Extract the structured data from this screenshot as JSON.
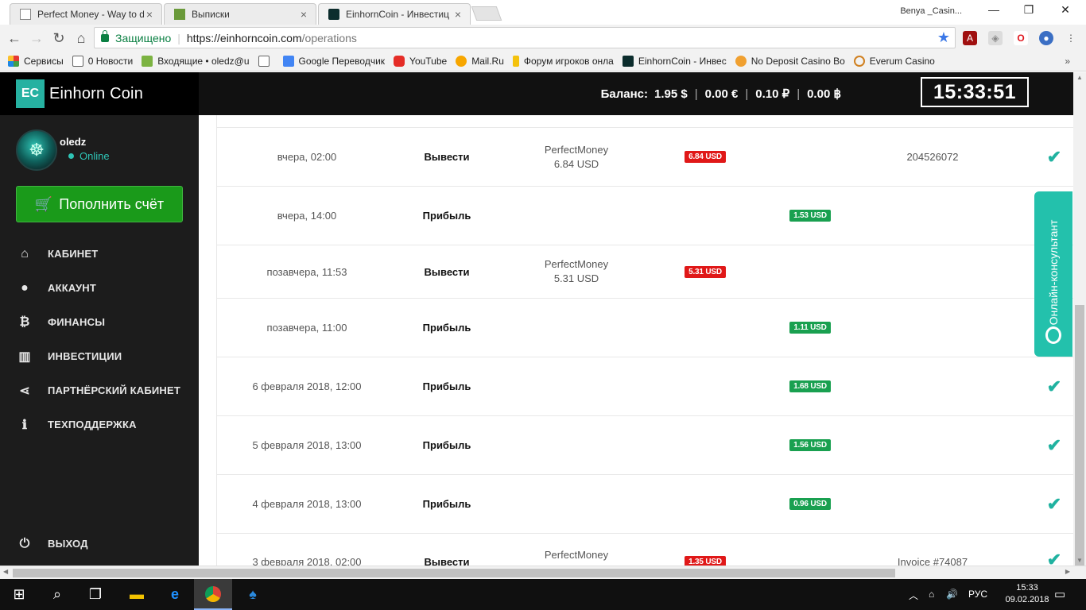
{
  "browser": {
    "tabs": [
      {
        "title": "Perfect Money - Way to d",
        "icon": "page-icon"
      },
      {
        "title": "Выписки",
        "icon": "privat-icon"
      },
      {
        "title": "EinhornCoin - Инвестиц",
        "icon": "einhorn-icon",
        "active": true
      }
    ],
    "profile_name": "Benya _Casin...",
    "window_controls": {
      "minimize": "—",
      "restore": "❐",
      "close": "✕"
    },
    "address": {
      "secure_label": "Защищено",
      "separator": "|",
      "url_host": "https://einhorncoin.com",
      "url_path": "/operations"
    },
    "bookmarks": [
      {
        "label": "Сервисы",
        "icon": "apps-icon",
        "color": "#e53935"
      },
      {
        "label": "0 Новости",
        "icon": "page-icon",
        "color": "#ffffff"
      },
      {
        "label": "Входящие • oledz@u",
        "icon": "mail-icon",
        "color": "#7cb342"
      },
      {
        "label": "",
        "icon": "page-icon",
        "color": "#ffffff"
      },
      {
        "label": "Google Переводчик",
        "icon": "translate-icon",
        "color": "#4285f4"
      },
      {
        "label": "YouTube",
        "icon": "youtube-icon",
        "color": "#e52d27"
      },
      {
        "label": "Mail.Ru",
        "icon": "mailru-icon",
        "color": "#f7a600"
      },
      {
        "label": "Форум игроков онла",
        "icon": "forum-icon",
        "color": "#f4c20d"
      },
      {
        "label": "EinhornCoin - Инвес",
        "icon": "einhorn-icon",
        "color": "#0c2d2d"
      },
      {
        "label": "No Deposit Casino Bo",
        "icon": "casino-icon",
        "color": "#f0a030"
      },
      {
        "label": "Everum Casino",
        "icon": "everum-icon",
        "color": "#d08020"
      }
    ],
    "bookmarks_more": "»"
  },
  "site": {
    "logo_mark": "EC",
    "logo_text": "Einhorn Coin",
    "user": {
      "name": "oledz",
      "status": "Online"
    },
    "topup_button": "Пополнить счёт",
    "menu": [
      {
        "label": "КАБИНЕТ",
        "icon": "home-icon",
        "glyph": "⌂"
      },
      {
        "label": "АККАУНТ",
        "icon": "user-icon",
        "glyph": "●"
      },
      {
        "label": "ФИНАНСЫ",
        "icon": "bitcoin-icon",
        "glyph": "₿"
      },
      {
        "label": "ИНВЕСТИЦИИ",
        "icon": "bar-chart-icon",
        "glyph": "▥"
      },
      {
        "label": "ПАРТНЁРСКИЙ КАБИНЕТ",
        "icon": "share-icon",
        "glyph": "⋖"
      },
      {
        "label": "ТЕХПОДДЕРЖКА",
        "icon": "info-icon",
        "glyph": "ℹ"
      }
    ],
    "logout": {
      "label": "ВЫХОД",
      "icon": "power-icon",
      "glyph": "⏻"
    },
    "balance": {
      "label": "Баланс:",
      "usd": "1.95 $",
      "eur": "0.00 €",
      "rub": "0.10 ₽",
      "btc": "0.00 ฿",
      "divider": "|"
    },
    "clock": "15:33:51",
    "operations": [
      {
        "date": "вчера, 02:00",
        "type": "Вывести",
        "system": "PerfectMoney",
        "system_amount": "6.84 USD",
        "debit": "6.84 USD",
        "credit": "",
        "ref": "204526072",
        "done": true
      },
      {
        "date": "вчера, 14:00",
        "type": "Прибыль",
        "system": "",
        "system_amount": "",
        "debit": "",
        "credit": "1.53 USD",
        "ref": "",
        "done": false
      },
      {
        "date": "позавчера, 11:53",
        "type": "Вывести",
        "system": "PerfectMoney",
        "system_amount": "5.31 USD",
        "debit": "5.31 USD",
        "credit": "",
        "ref": "",
        "done": false
      },
      {
        "date": "позавчера, 11:00",
        "type": "Прибыль",
        "system": "",
        "system_amount": "",
        "debit": "",
        "credit": "1.11 USD",
        "ref": "",
        "done": false
      },
      {
        "date": "6 февраля 2018, 12:00",
        "type": "Прибыль",
        "system": "",
        "system_amount": "",
        "debit": "",
        "credit": "1.68 USD",
        "ref": "",
        "done": true
      },
      {
        "date": "5 февраля 2018, 13:00",
        "type": "Прибыль",
        "system": "",
        "system_amount": "",
        "debit": "",
        "credit": "1.56 USD",
        "ref": "",
        "done": true
      },
      {
        "date": "4 февраля 2018, 13:00",
        "type": "Прибыль",
        "system": "",
        "system_amount": "",
        "debit": "",
        "credit": "0.96 USD",
        "ref": "",
        "done": true
      },
      {
        "date": "3 февраля 2018, 02:00",
        "type": "Вывести",
        "system": "PerfectMoney",
        "system_amount": "",
        "debit": "1.35 USD",
        "credit": "",
        "ref": "Invoice #74087",
        "done": true
      }
    ],
    "consultant_label": "Онлайн-консультант"
  },
  "taskbar": {
    "language": "РУС",
    "time": "15:33",
    "date": "09.02.2018"
  },
  "colors": {
    "accent": "#26b1a1",
    "sidebar_bg": "#1c1c1c",
    "topup_green": "#1a9a1a",
    "debit_red": "#e01818",
    "credit_green": "#19a050"
  }
}
